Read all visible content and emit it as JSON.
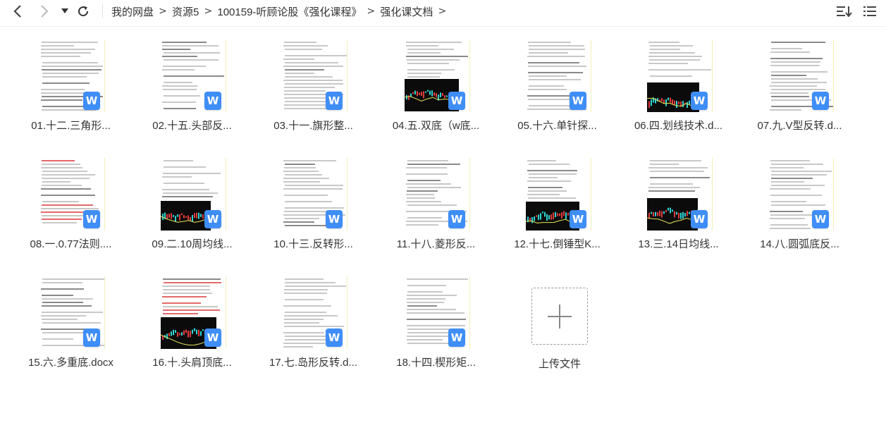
{
  "toolbar": {
    "back_icon": "chevron-left-icon",
    "forward_icon": "chevron-right-icon",
    "history_icon": "caret-down-icon",
    "refresh_icon": "refresh-icon",
    "sort_icon": "sort-icon",
    "view_icon": "list-view-icon"
  },
  "breadcrumb": {
    "items": [
      "我的网盘",
      "资源5",
      "100159-听顾论股《强化课程》",
      "强化课文档"
    ],
    "separator": ">"
  },
  "files": [
    {
      "name": "01.十二.三角形...",
      "chart": false
    },
    {
      "name": "02.十五.头部反...",
      "chart": false
    },
    {
      "name": "03.十一.旗形整...",
      "chart": false
    },
    {
      "name": "04.五.双底（w底...",
      "chart": true
    },
    {
      "name": "05.十六.单针探...",
      "chart": false
    },
    {
      "name": "06.四.划线技术.d...",
      "chart": true
    },
    {
      "name": "07.九.V型反转.d...",
      "chart": false
    },
    {
      "name": "08.一.0.77法则....",
      "chart": false
    },
    {
      "name": "09.二.10周均线...",
      "chart": true
    },
    {
      "name": "10.十三.反转形...",
      "chart": false
    },
    {
      "name": "11.十八.菱形反...",
      "chart": false
    },
    {
      "name": "12.十七.倒锤型K...",
      "chart": true
    },
    {
      "name": "13.三.14日均线...",
      "chart": true
    },
    {
      "name": "14.八.圆弧底反...",
      "chart": false
    },
    {
      "name": "15.六.多重底.docx",
      "chart": false
    },
    {
      "name": "16.十.头肩顶底...",
      "chart": true
    },
    {
      "name": "17.七.岛形反转.d...",
      "chart": false
    },
    {
      "name": "18.十四.楔形矩...",
      "chart": false
    }
  ],
  "file_badge": "W",
  "upload": {
    "label": "上传文件",
    "icon": "plus-icon"
  }
}
